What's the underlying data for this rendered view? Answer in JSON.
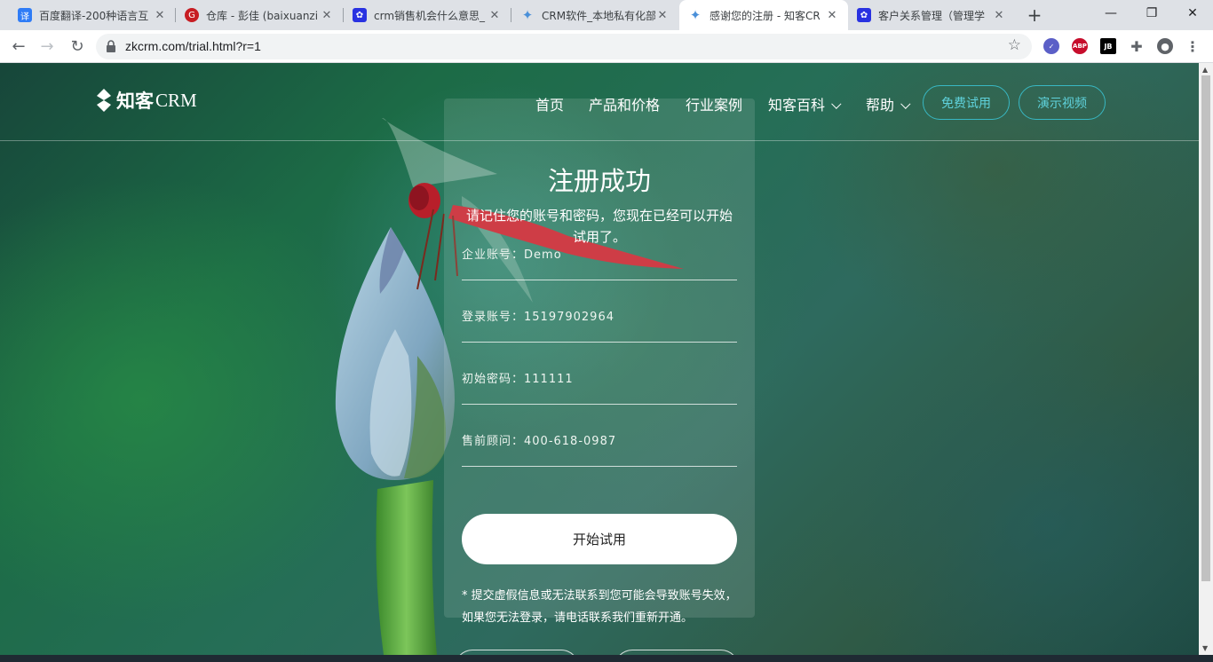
{
  "browser": {
    "tabs": [
      {
        "title": "百度翻译-200种语言互",
        "favicon": "baidu-translate-icon",
        "color": "#2f7cf6",
        "glyph": "译"
      },
      {
        "title": "仓库 - 彭佳 (baixuanzi",
        "favicon": "gitee-icon",
        "color": "#c71d23",
        "glyph": "G"
      },
      {
        "title": "crm销售机会什么意思_",
        "favicon": "baidu-paw-icon",
        "color": "#2932e1",
        "glyph": "✿"
      },
      {
        "title": "CRM软件_本地私有化部",
        "favicon": "zkcrm-icon",
        "color": "#4a90d9",
        "glyph": "✦"
      },
      {
        "title": "感谢您的注册 - 知客CR",
        "favicon": "zkcrm-icon",
        "color": "#4a90d9",
        "glyph": "✦"
      },
      {
        "title": "客户关系管理（管理学",
        "favicon": "baidu-paw-icon",
        "color": "#2932e1",
        "glyph": "✿"
      }
    ],
    "url": "zkcrm.com/trial.html?r=1",
    "extensions": [
      {
        "name": "checkmark-extension-icon",
        "color": "#5b5fc7",
        "glyph": "✓"
      },
      {
        "name": "adblock-plus-icon",
        "color": "#c70d2c",
        "glyph": "ABP"
      },
      {
        "name": "jetbrains-icon",
        "color": "#000000",
        "glyph": "JB"
      }
    ]
  },
  "site": {
    "logo_cn": "知客",
    "logo_en": "CRM",
    "nav": [
      {
        "label": "首页"
      },
      {
        "label": "产品和价格"
      },
      {
        "label": "行业案例"
      },
      {
        "label": "知客百科"
      },
      {
        "label": "帮助"
      }
    ],
    "trial_button": "免费试用",
    "demo_button": "演示视频"
  },
  "card": {
    "title": "注册成功",
    "subtitle": "请记住您的账号和密码，您现在已经可以开始试用了。",
    "fields": [
      {
        "label": "企业账号：",
        "value": "Demo"
      },
      {
        "label": "登录账号：",
        "value": "15197902964"
      },
      {
        "label": "初始密码：",
        "value": "111111"
      },
      {
        "label": "售前顾问：",
        "value": "400-618-0987"
      }
    ],
    "start_button": "开始试用",
    "note": "* 提交虚假信息或无法联系到您可能会导致账号失效，如果您无法登录，请电话联系我们重新开通。"
  },
  "colors": {
    "accent": "#38b8c4",
    "overlay": "rgba(255,255,255,0.12)"
  }
}
